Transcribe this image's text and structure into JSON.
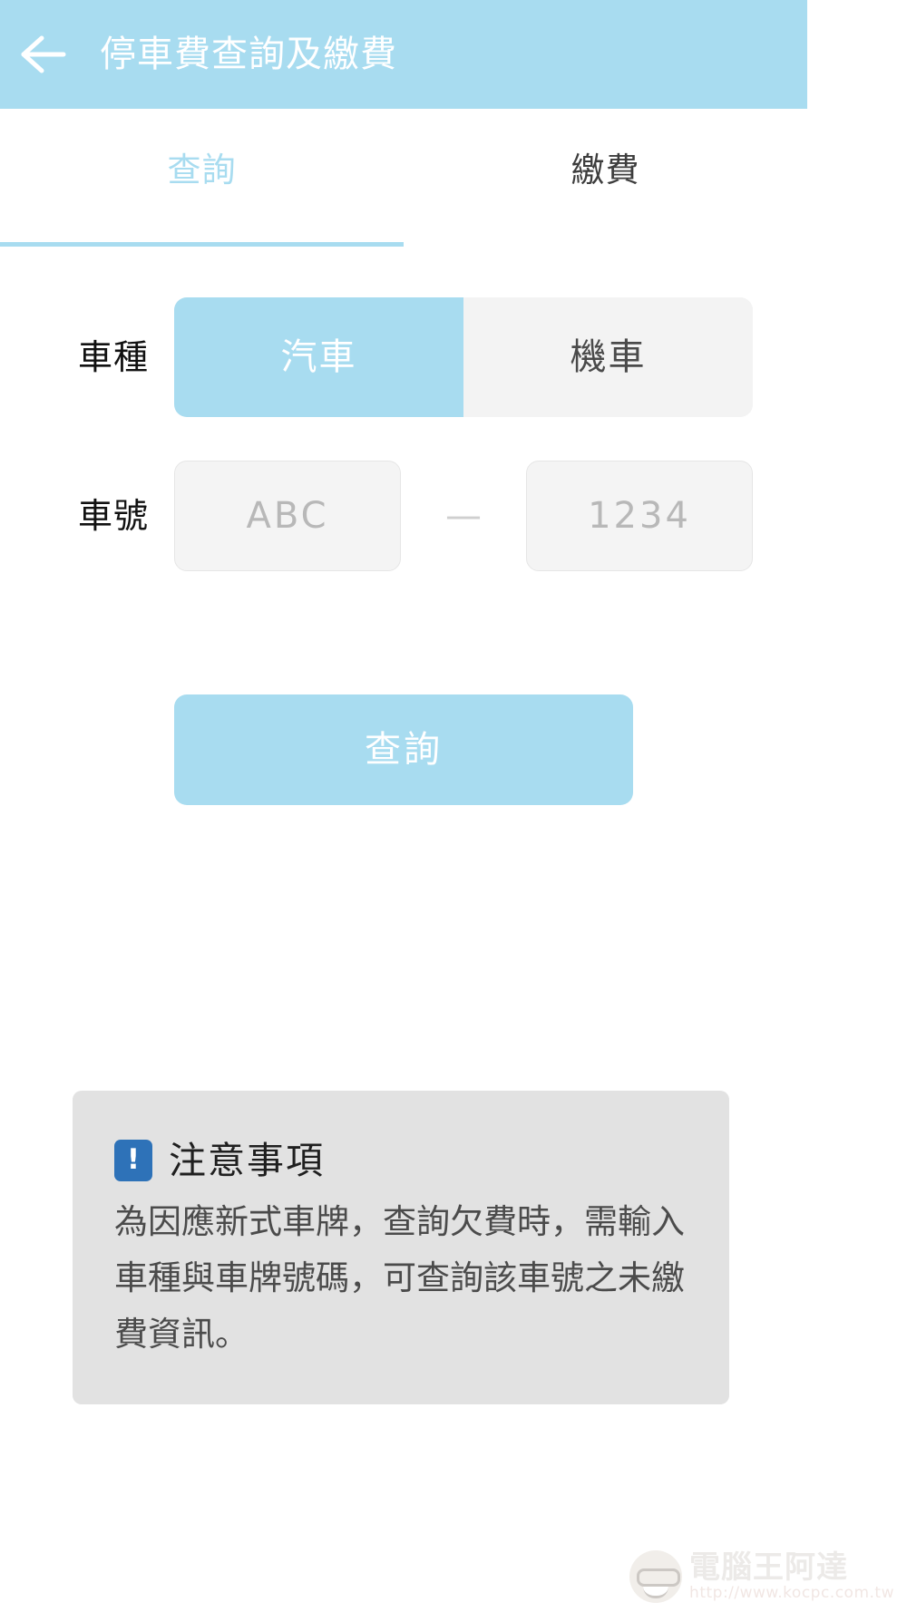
{
  "header": {
    "title": "停車費查詢及繳費",
    "back_icon": "arrow-left-icon",
    "background_color": "#a8dcf0",
    "title_color": "#ffffff"
  },
  "tabs": {
    "items": [
      {
        "label": "查詢",
        "active": true
      },
      {
        "label": "繳費",
        "active": false
      }
    ],
    "active_color": "#a8dcf0",
    "inactive_color": "#3d3d3d"
  },
  "form": {
    "vehicle_type": {
      "label": "車種",
      "options": [
        {
          "label": "汽車",
          "selected": true
        },
        {
          "label": "機車",
          "selected": false
        }
      ],
      "selected_background": "#a8dcf0",
      "unselected_background": "#f3f3f3"
    },
    "plate": {
      "label": "車號",
      "prefix_value": "",
      "prefix_placeholder": "ABC",
      "separator": "—",
      "suffix_value": "",
      "suffix_placeholder": "1234"
    },
    "submit": {
      "label": "查詢",
      "background_color": "#a8dcf0"
    }
  },
  "notice": {
    "icon": "exclamation-mark-icon",
    "icon_glyph": "!",
    "icon_color": "#2e72b8",
    "title": "注意事項",
    "body": "為因應新式車牌，查詢欠費時，需輸入車種與車牌號碼，可查詢該車號之未繳費資訊。",
    "background_color": "#e2e2e2"
  },
  "watermark": {
    "brand": "電腦王阿達",
    "url": "http://www.kocpc.com.tw",
    "logo_icon": "cartoon-face-icon"
  }
}
